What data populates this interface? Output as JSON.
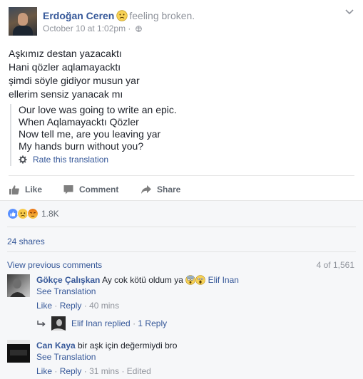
{
  "post": {
    "author": "Erdoğan Ceren",
    "feeling": "feeling broken.",
    "timestamp": "October 10 at 1:02pm",
    "separator": "·",
    "lines": [
      "Aşkımız destan yazacaktı",
      "Hani qözler aqlamayacktı",
      "şimdi söyle gidiyor musun yar",
      "ellerim sensiz yanacak mı"
    ],
    "translation": [
      "Our love was going to write an epic.",
      "When Aqlamayacktı Qözler",
      "Now tell me, are you leaving yar",
      "My hands burn without you?"
    ],
    "rate_label": "Rate this translation"
  },
  "actions": {
    "like": "Like",
    "comment": "Comment",
    "share": "Share"
  },
  "social": {
    "reaction_count": "1.8K",
    "shares": "24 shares",
    "view_previous": "View previous comments",
    "pager": "4 of 1,561"
  },
  "comments": [
    {
      "author": "Gökçe Çalışkan",
      "text": "Ay cok kötü oldum ya",
      "tag": "Elif Inan",
      "see_translation": "See Translation",
      "like": "Like",
      "reply": "Reply",
      "time": "40 mins",
      "replies": {
        "author": "Elif Inan",
        "replied": "replied",
        "count": "1 Reply"
      }
    },
    {
      "author": "Can Kaya",
      "text": "bir aşk için değermiydi bro",
      "see_translation": "See Translation",
      "like": "Like",
      "reply": "Reply",
      "time": "31 mins",
      "edited": "Edited"
    }
  ],
  "sep": "·",
  "colors": {
    "link": "#365899",
    "muted": "#90949c",
    "like_blue": "#5890ff",
    "sad_yellow": "#f7c948",
    "angry_red": "#e9710f"
  }
}
